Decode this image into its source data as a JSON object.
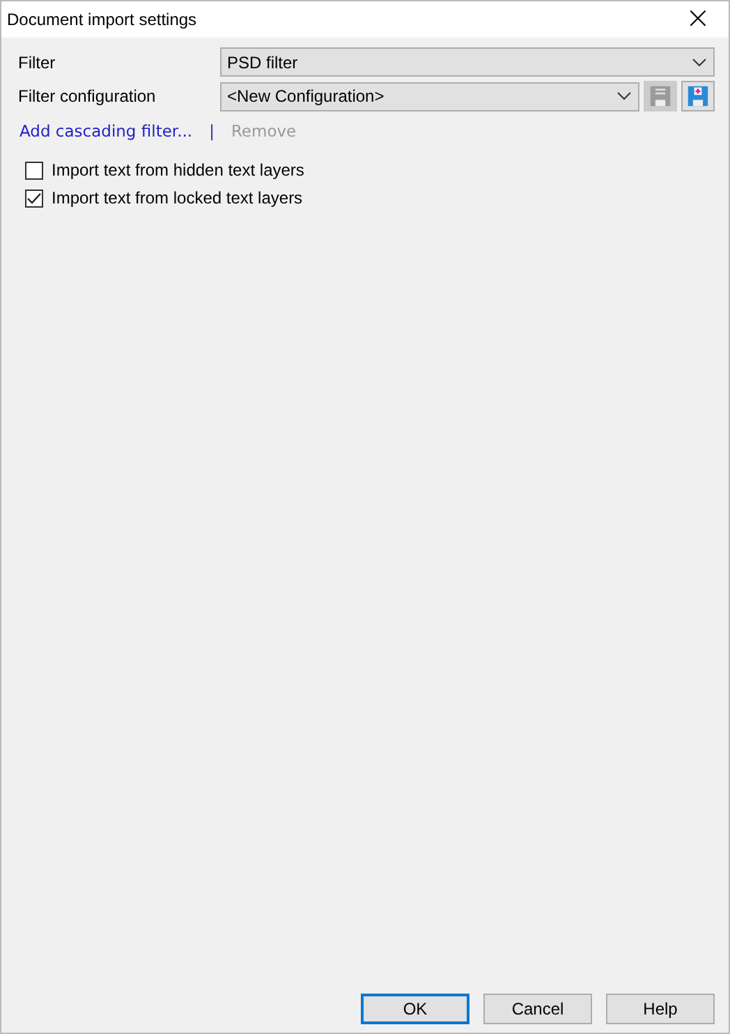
{
  "window": {
    "title": "Document import settings",
    "close": "×"
  },
  "filter": {
    "label": "Filter",
    "value": "PSD filter"
  },
  "configuration": {
    "label": "Filter configuration",
    "value": "<New Configuration>",
    "tools": [
      {
        "kind": "save",
        "disabled": true
      },
      {
        "kind": "save-new",
        "disabled": false
      }
    ]
  },
  "links": [
    {
      "label": "Add cascading filter...",
      "disabled": false
    },
    {
      "label": "Remove",
      "disabled": true
    }
  ],
  "separator": "|",
  "options": [
    {
      "label": "Import text from hidden text layers",
      "checked": false
    },
    {
      "label": "Import text from locked text layers",
      "checked": true
    }
  ],
  "buttons": [
    {
      "label": "OK",
      "default": true
    },
    {
      "label": "Cancel",
      "default": false
    },
    {
      "label": "Help",
      "default": false
    }
  ]
}
